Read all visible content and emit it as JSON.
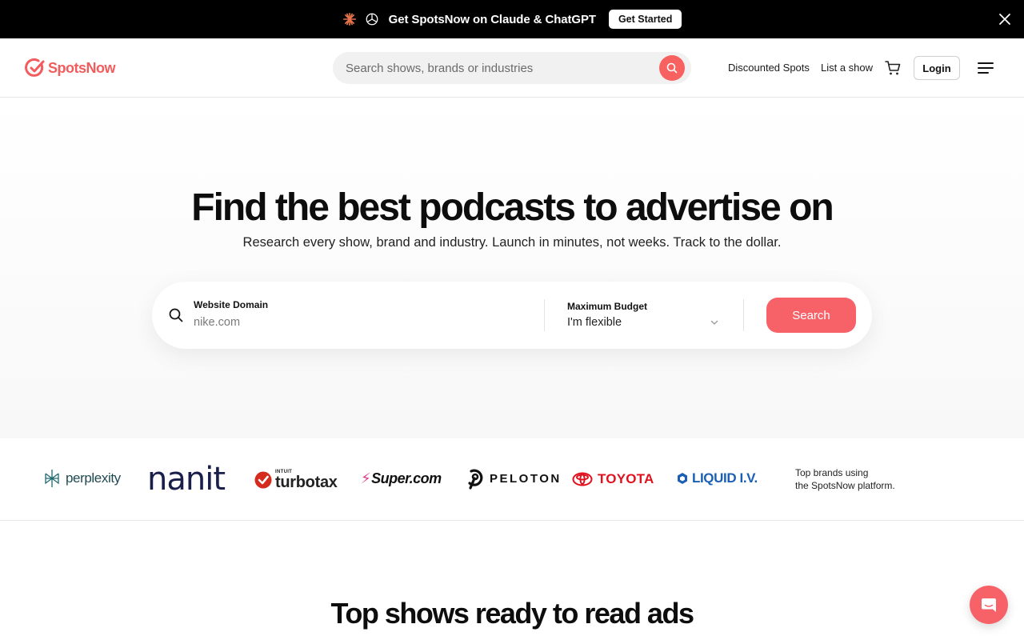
{
  "announcement": {
    "message": "Get SpotsNow on Claude & ChatGPT",
    "cta_label": "Get Started"
  },
  "header": {
    "logo_text": "SpotsNow",
    "search_placeholder": "Search shows, brands or industries",
    "nav": {
      "discounted": "Discounted Spots",
      "list_show": "List a show",
      "login": "Login"
    }
  },
  "hero": {
    "title": "Find the best podcasts to advertise on",
    "subtitle": "Research every show, brand and industry. Launch in minutes, not weeks. Track to the dollar.",
    "search": {
      "domain_label": "Website Domain",
      "domain_placeholder": "nike.com",
      "budget_label": "Maximum Budget",
      "budget_value": "I'm flexible",
      "button_label": "Search"
    }
  },
  "brands": {
    "logos": {
      "perplexity": "perplexity",
      "nanit": "nanit",
      "intuit": "INTUIT",
      "turbotax": "turbotax",
      "super": "Super.com",
      "peloton": "PELOTON",
      "toyota": "TOYOTA",
      "liquid": "LIQUID I.V."
    },
    "note_line1": "Top brands using",
    "note_line2": "the SpotsNow platform."
  },
  "top_shows": {
    "heading": "Top shows ready to read ads"
  },
  "colors": {
    "brand_coral": "#f76268",
    "logo_red": "#f25c5c",
    "announcement_bg": "#000000"
  },
  "icons": [
    "sparkle-icon",
    "openai-icon",
    "close-icon",
    "search-icon",
    "cart-icon",
    "menu-icon",
    "chevron-down-icon",
    "chat-icon"
  ]
}
